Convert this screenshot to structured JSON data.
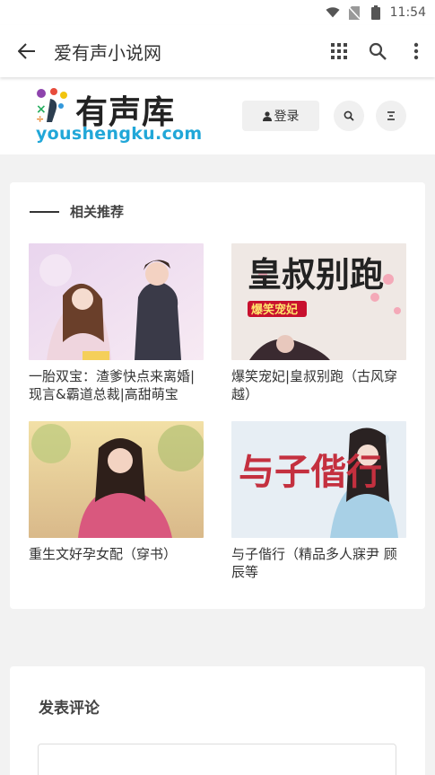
{
  "status_bar": {
    "time": "11:54",
    "icons": [
      "wifi-icon",
      "no-sim-icon",
      "battery-icon"
    ]
  },
  "app_bar": {
    "title": "爱有声小说网",
    "icons": [
      "back-arrow-icon",
      "grid-apps-icon",
      "search-icon",
      "more-vert-icon"
    ]
  },
  "site_header": {
    "logo_text": "有声库",
    "logo_domain": "youshengku.com",
    "login_label": "登录",
    "icons": [
      "user-icon",
      "search-icon",
      "menu-icon"
    ]
  },
  "recommend": {
    "title": "相关推荐",
    "books": [
      {
        "title": "一胎双宝：渣爹快点来离婚|现言&霸道总裁|高甜萌宝"
      },
      {
        "title": "爆笑宠妃|皇叔别跑（古风穿越）",
        "cover_text": "皇叔别跑",
        "cover_badge": "爆笑宠妃"
      },
      {
        "title": "重生文好孕女配（穿书）"
      },
      {
        "title": "与子偕行（精品多人寐尹 顾辰等",
        "cover_text": "与子偕行"
      }
    ]
  },
  "comment": {
    "title": "发表评论"
  },
  "colors": {
    "accent_blue": "#21a7d8",
    "background": "#f2f2f2",
    "card": "#ffffff"
  }
}
